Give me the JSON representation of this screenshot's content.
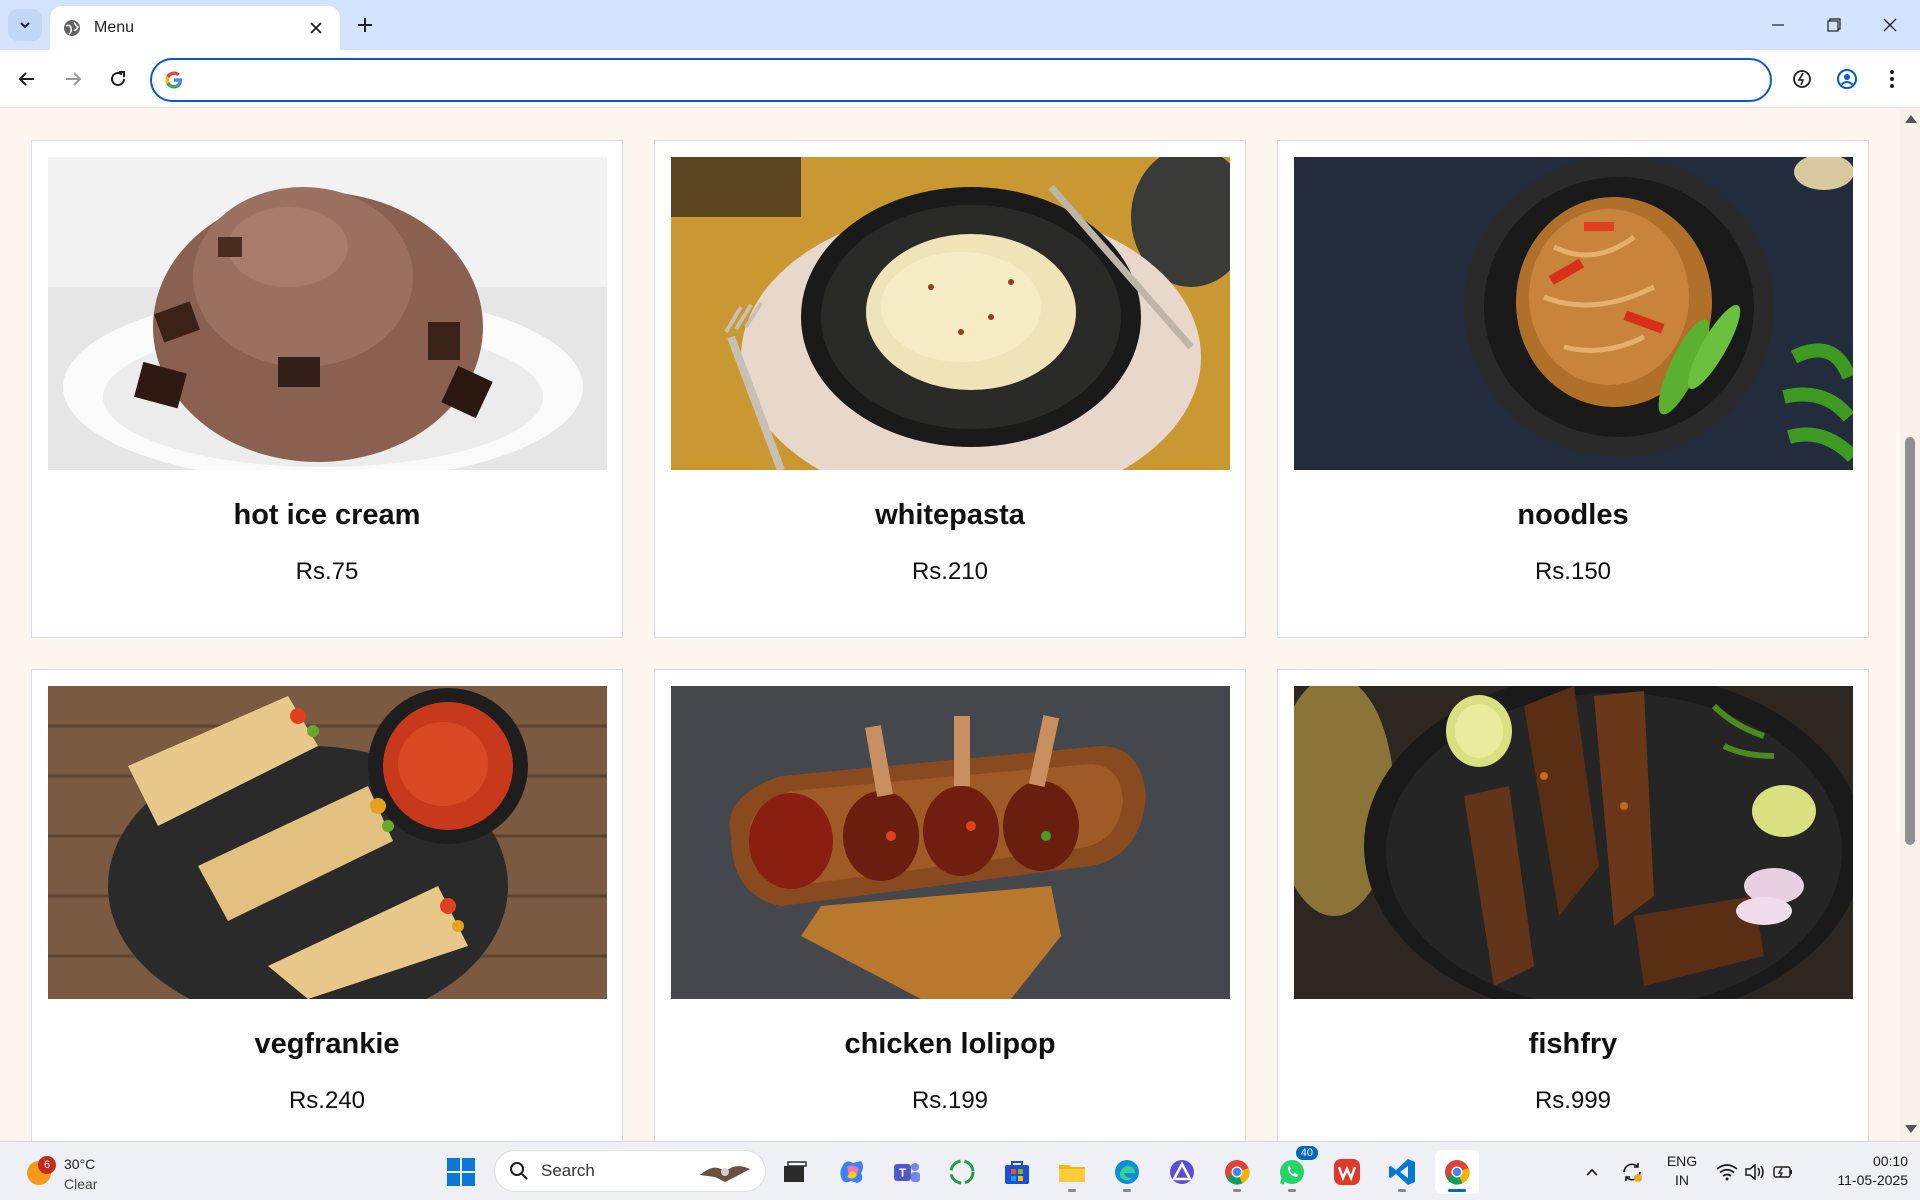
{
  "browser": {
    "tab_title": "Menu",
    "address_value": "",
    "address_placeholder": ""
  },
  "menu": {
    "items": [
      {
        "name": "hot ice cream",
        "price": "Rs.75",
        "image": "chocolate-ice-cream-photo"
      },
      {
        "name": "whitepasta",
        "price": "Rs.210",
        "image": "white-pasta-photo"
      },
      {
        "name": "noodles",
        "price": "Rs.150",
        "image": "noodles-photo"
      },
      {
        "name": "vegfrankie",
        "price": "Rs.240",
        "image": "veg-frankie-photo"
      },
      {
        "name": "chicken lolipop",
        "price": "Rs.199",
        "image": "chicken-lollipop-photo"
      },
      {
        "name": "fishfry",
        "price": "Rs.999",
        "image": "fish-fry-photo"
      }
    ]
  },
  "taskbar": {
    "weather_temp": "30°C",
    "weather_cond": "Clear",
    "weather_badge": "6",
    "search_label": "Search",
    "whatsapp_badge": "40",
    "lang_top": "ENG",
    "lang_bottom": "IN",
    "time": "00:10",
    "date": "11-05-2025"
  },
  "colors": {
    "accent": "#0b57d0",
    "tab_strip": "#d3e3fd",
    "page_bg": "#fdf6ee"
  }
}
